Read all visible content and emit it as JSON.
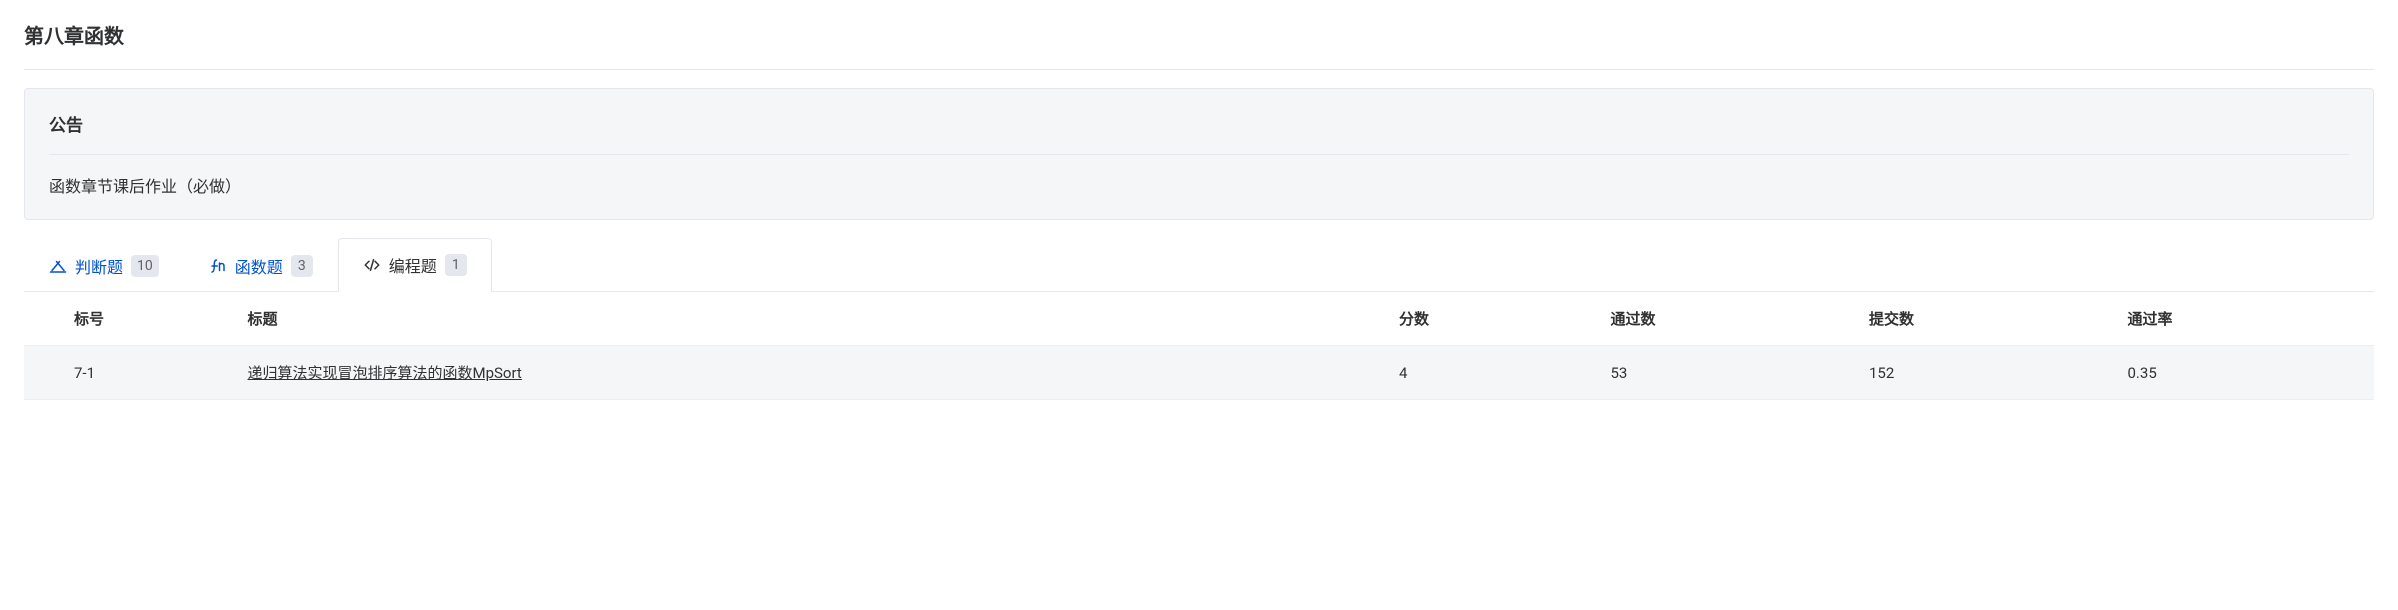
{
  "page": {
    "title": "第八章函数"
  },
  "notice": {
    "header": "公告",
    "body": "函数章节课后作业（必做）"
  },
  "tabs": [
    {
      "icon": "judge",
      "label": "判断题",
      "count": "10",
      "active": false
    },
    {
      "icon": "fn",
      "label": "函数题",
      "count": "3",
      "active": false
    },
    {
      "icon": "code",
      "label": "编程题",
      "count": "1",
      "active": true
    }
  ],
  "table": {
    "headers": {
      "id": "标号",
      "title": "标题",
      "score": "分数",
      "pass": "通过数",
      "submit": "提交数",
      "rate": "通过率"
    },
    "rows": [
      {
        "id": "7-1",
        "title": "递归算法实现冒泡排序算法的函数MpSort",
        "score": "4",
        "pass": "53",
        "submit": "152",
        "rate": "0.35"
      }
    ]
  }
}
